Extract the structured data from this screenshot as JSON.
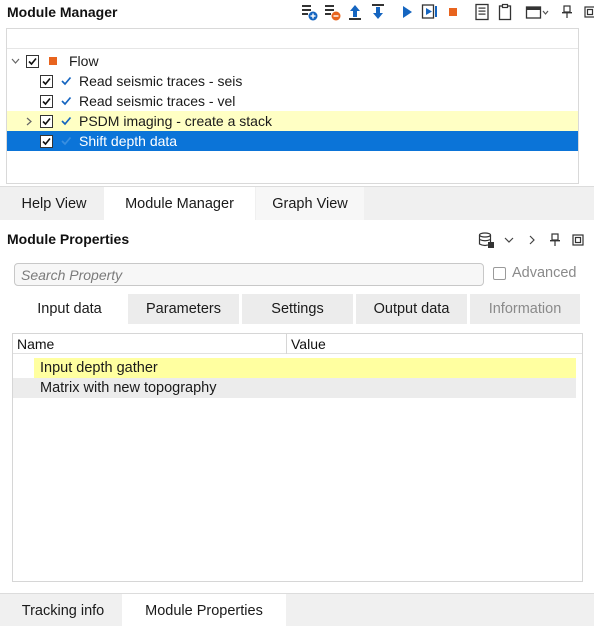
{
  "module_manager": {
    "title": "Module Manager",
    "toolbar_icons": [
      "add-module-icon",
      "remove-module-icon",
      "move-up-icon",
      "move-down-icon",
      "run-icon",
      "run-step-icon",
      "stop-icon",
      "notes-icon",
      "clipboard-icon",
      "layout-icon",
      "pin-icon",
      "float-icon"
    ],
    "tree": [
      {
        "label": "Flow",
        "checked": true,
        "expandable": true,
        "expanded": true,
        "indent": 0
      },
      {
        "label": "Read seismic traces - seis",
        "checked": true,
        "indent": 1
      },
      {
        "label": "Read seismic traces - vel",
        "checked": true,
        "indent": 1
      },
      {
        "label": "PSDM imaging - create a stack",
        "checked": true,
        "indent": 1,
        "expandable": true,
        "highlighted": true
      },
      {
        "label": "Shift depth data",
        "checked": true,
        "indent": 1,
        "selected": true
      }
    ],
    "tabs": [
      {
        "label": "Help View",
        "active": false
      },
      {
        "label": "Module Manager",
        "active": true
      },
      {
        "label": "Graph View",
        "active": false
      }
    ]
  },
  "module_properties": {
    "title": "Module Properties",
    "search": {
      "placeholder": "Search Property",
      "value": ""
    },
    "advanced": {
      "label": "Advanced",
      "checked": false
    },
    "tabs": [
      {
        "label": "Input data",
        "active": true
      },
      {
        "label": "Parameters",
        "active": false
      },
      {
        "label": "Settings",
        "active": false
      },
      {
        "label": "Output data",
        "active": false
      },
      {
        "label": "Information",
        "active": false,
        "disabled": true
      }
    ],
    "grid": {
      "columns": [
        "Name",
        "Value"
      ],
      "rows": [
        {
          "name": "Input depth gather",
          "value": "",
          "highlighted": true
        },
        {
          "name": "Matrix with new topography",
          "value": "",
          "highlighted": false
        }
      ]
    }
  },
  "bottom_tabs": [
    {
      "label": "Tracking info",
      "active": false
    },
    {
      "label": "Module Properties",
      "active": true
    }
  ],
  "colors": {
    "selection": "#0b74d8",
    "highlight": "#ffffc4",
    "flow_square": "#e8641e",
    "toolbar_blue": "#1565c0",
    "stop_orange": "#e8641e"
  }
}
